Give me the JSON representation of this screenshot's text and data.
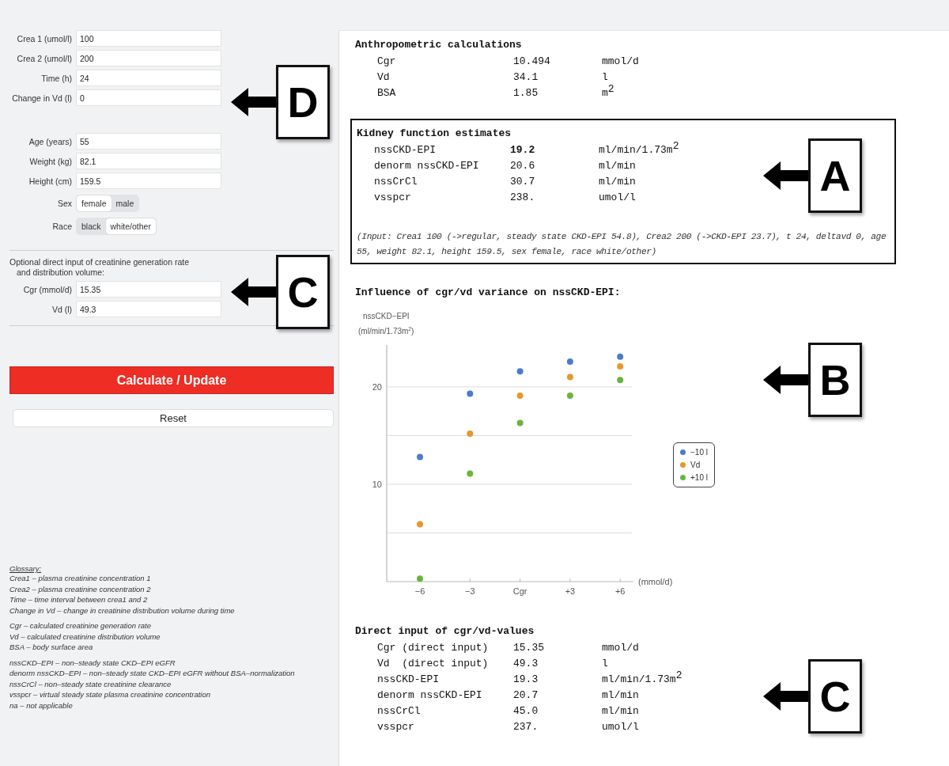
{
  "inputs_main": [
    {
      "label": "Crea 1 (umol/l)",
      "value": "100"
    },
    {
      "label": "Crea 2 (umol/l)",
      "value": "200"
    },
    {
      "label": "Time (h)",
      "value": "24"
    },
    {
      "label": "Change in Vd (l)",
      "value": "0"
    }
  ],
  "inputs_patient": [
    {
      "label": "Age (years)",
      "value": "55"
    },
    {
      "label": "Weight (kg)",
      "value": "82.1"
    },
    {
      "label": "Height (cm)",
      "value": "159.5"
    }
  ],
  "toggles": [
    {
      "label": "Sex",
      "options": [
        {
          "label": "female",
          "selected": true
        },
        {
          "label": "male",
          "selected": false
        }
      ]
    },
    {
      "label": "Race",
      "options": [
        {
          "label": "black",
          "selected": false
        },
        {
          "label": "white/other",
          "selected": true
        }
      ]
    }
  ],
  "optional": {
    "text": "Optional direct input of creatinine generation rate",
    "text_2": "and distribution volume:",
    "inputs": [
      {
        "label": "Cgr (mmol/d)",
        "value": "15.35"
      },
      {
        "label": "Vd (l)",
        "value": "49.3"
      }
    ]
  },
  "buttons": {
    "calculate": "Calculate / Update",
    "reset": "Reset"
  },
  "glossary": {
    "title": "Glossary:",
    "groups": [
      [
        "Crea1 – plasma creatinine concentration 1",
        "Crea2 – plasma creatinine concentration 2",
        "Time – time interval between crea1 and 2",
        "Change in Vd – change in creatinine distribution volume during time"
      ],
      [
        "Cgr – calculated creatinine generation rate",
        "Vd – calculated creatinine distribution volume",
        "BSA – body surface area"
      ],
      [
        "nssCKD–EPI – non–steady state CKD–EPI eGFR",
        "denorm nssCKD–EPI – non–steady state CKD–EPI eGFR without BSA–normalization",
        "nssCrCl – non–steady state creatinine clearance",
        "vsspcr – virtual steady state plasma creatinine concentration",
        "na – not applicable"
      ]
    ]
  },
  "anthropometric": {
    "title": "Anthropometric calculations",
    "rows": [
      {
        "name": "Cgr",
        "value": "10.494",
        "unit": "mmol/d"
      },
      {
        "name": "Vd",
        "value": "34.1",
        "unit": "l"
      },
      {
        "name": "BSA",
        "value": "1.85",
        "unit": "m$^{2}$"
      }
    ]
  },
  "kidney": {
    "title": "Kidney function estimates",
    "rows": [
      {
        "name": "nssCKD-EPI",
        "value": "19.2",
        "unit": "ml/min/1.73m$^{2}$",
        "bold": true
      },
      {
        "name": "denorm nssCKD-EPI",
        "value": "20.6",
        "unit": "ml/min",
        "bold": false
      },
      {
        "name": "nssCrCl",
        "value": "30.7",
        "unit": "ml/min",
        "bold": false
      },
      {
        "name": "vsspcr",
        "value": "238.",
        "unit": "umol/l",
        "bold": false
      }
    ],
    "note": "(Input: Crea1 100 (->regular, steady state CKD-EPI 54.8), Crea2 200 (->CKD-EPI 23.7), t 24, deltavd 0, age 55, weight 82.1, height 159.5, sex female, race white/other)"
  },
  "influence": {
    "title": "Influence of cgr/vd variance on nssCKD-EPI:",
    "ylabel_1": "nssCKD−EPI",
    "ylabel_2": "(ml/min/1.73m$^{2}$)",
    "chart_data": {
      "type": "scatter",
      "legend": "right",
      "xlabel": "(mmol/d)",
      "categories": [
        "−6",
        "−3",
        "Cgr",
        "+3",
        "+6"
      ],
      "ylim": [
        0,
        24.3
      ],
      "yticks": [
        10,
        20
      ],
      "series": [
        {
          "name": "−10 l",
          "color": "#4a7cc9",
          "values": [
            12.8,
            19.3,
            21.6,
            22.6,
            23.1
          ]
        },
        {
          "name": "Vd",
          "color": "#e8962e",
          "values": [
            5.9,
            15.2,
            19.1,
            21.0,
            22.1
          ]
        },
        {
          "name": "+10 l",
          "color": "#6ab43e",
          "values": [
            0.3,
            11.1,
            16.3,
            19.1,
            20.7
          ]
        }
      ]
    }
  },
  "direct": {
    "title": "Direct input of cgr/vd-values",
    "rows": [
      {
        "name": "Cgr (direct input)",
        "value": "15.35",
        "unit": "mmol/d"
      },
      {
        "name": "Vd  (direct input)",
        "value": "49.3",
        "unit": "l"
      },
      {
        "name": "nssCKD-EPI",
        "value": "19.3",
        "unit": "ml/min/1.73m$^{2}$"
      },
      {
        "name": "denorm nssCKD-EPI",
        "value": "20.7",
        "unit": "ml/min"
      },
      {
        "name": "nssCrCl",
        "value": "45.0",
        "unit": "ml/min"
      },
      {
        "name": "vsspcr",
        "value": "237.",
        "unit": "umol/l"
      }
    ]
  },
  "callouts": [
    {
      "letter": "D"
    },
    {
      "letter": "C"
    },
    {
      "letter": "A"
    },
    {
      "letter": "B"
    },
    {
      "letter": "C"
    }
  ]
}
